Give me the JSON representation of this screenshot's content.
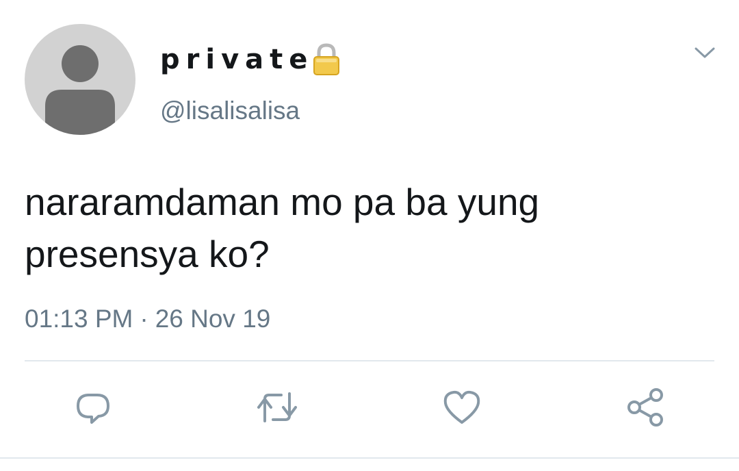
{
  "tweet": {
    "display_name": "private",
    "handle": "@lisalisalisa",
    "text": "nararamdaman mo pa ba yung presensya ko?",
    "time": "01:13 PM",
    "separator": "·",
    "date": "26 Nov 19"
  },
  "icons": {
    "avatar": "default-profile-icon",
    "lock": "lock-icon",
    "menu": "chevron-down-icon",
    "reply": "reply-icon",
    "retweet": "retweet-icon",
    "like": "heart-icon",
    "share": "share-icon"
  },
  "colors": {
    "text_primary": "#14171a",
    "text_secondary": "#657786",
    "divider": "#e1e8ed",
    "avatar_bg": "#d2d2d2",
    "avatar_figure": "#6e6e6e",
    "lock_gold": "#f2c94c"
  }
}
